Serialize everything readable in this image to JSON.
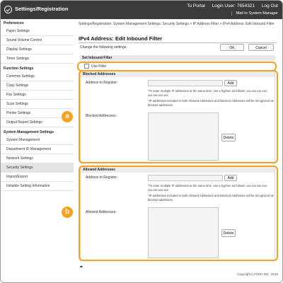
{
  "header": {
    "title": "Settings/Registration",
    "links": [
      "To Portal",
      "Login User: 7654321",
      "Log Out"
    ],
    "mail": "Mail to System Manager"
  },
  "sidebar": {
    "sections": [
      {
        "label": "Preferences"
      },
      {
        "label": "Function Settings"
      },
      {
        "label": "System Management Settings"
      }
    ],
    "items": [
      {
        "label": "Paper Settings"
      },
      {
        "label": "Sound Volume Control"
      },
      {
        "label": "Display Settings"
      },
      {
        "label": "Timer Settings"
      },
      {
        "label": "Common Settings"
      },
      {
        "label": "Copy Settings"
      },
      {
        "label": "Fax Settings"
      },
      {
        "label": "Scan Settings"
      },
      {
        "label": "Printer Settings"
      },
      {
        "label": "Output Report Settings"
      },
      {
        "label": "System Management"
      },
      {
        "label": "Department ID Management"
      },
      {
        "label": "Network Settings"
      },
      {
        "label": "Security Settings",
        "active": true
      },
      {
        "label": "Import/Export"
      },
      {
        "label": "Initialize Setting Information"
      }
    ]
  },
  "main": {
    "breadcrumb": "Settings/Registration: System Management Settings: Security Settings > IP Address Filter > IPv4 Address: Edit Inbound Filter",
    "title": "IPv4 Address: Edit Inbound Filter",
    "change_text": "Change the following settings.",
    "ok_label": "OK",
    "cancel_label": "Cancel",
    "set_filter_head": "Set Inbound Filter",
    "use_filter_label": "Use Filter",
    "blocked": {
      "head": "Blocked Addresses",
      "register_label": "Address to Register:",
      "add_label": "Add",
      "note1": "*To enter multiple IP addresses at the same time, use a hyphen as follows: xxx.xxx.xxx.xxx-xxx.xxx.xxx.xxx",
      "note2": "*IP addresses included in both Allowed Addresses and Blocked Addresses will be recognized as blocked addresses.",
      "list_label": "Blocked Addresses:",
      "delete_label": "Delete"
    },
    "allowed": {
      "head": "Allowed Addresses",
      "register_label": "Address to Register:",
      "add_label": "Add",
      "note1": "*To enter multiple IP addresses at the same time, use a hyphen as follows: xxx.xxx.xxx.xxx-xxx.xxx.xxx.xxx",
      "note2": "*IP addresses included in both Allowed Addresses and Blocked Addresses will be recognized as blocked addresses.",
      "list_label": "Allowed Addresses:",
      "delete_label": "Delete"
    },
    "badge_a": "a",
    "badge_b": "b",
    "scroll_top": "⏶",
    "copyright": "Copyright CANON INC. 2016"
  },
  "colors": {
    "accent": "#f4a21f",
    "header_bg": "#3b3b3b"
  }
}
